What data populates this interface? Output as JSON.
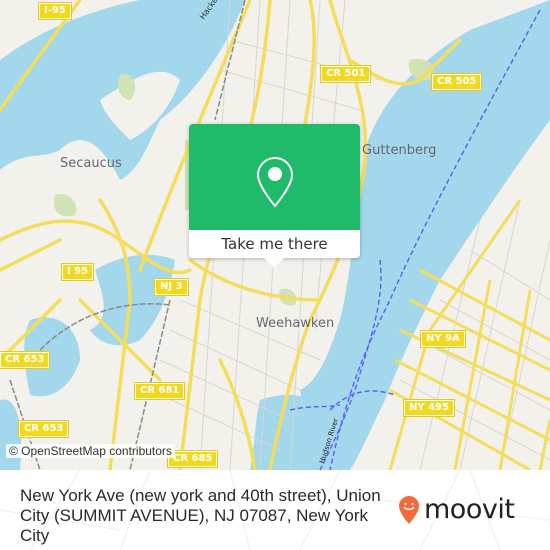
{
  "map": {
    "attribution": "© OpenStreetMap contributors",
    "colors": {
      "land": "#f2f1ec",
      "water": "#a3d7ec",
      "park": "#cfe3b4",
      "road_major": "#f5dd5c",
      "road_minor": "#d8d6cf",
      "rail": "#8a8a8a",
      "ferry": "#5a5ef0"
    },
    "place_labels": [
      {
        "name": "Secaucus"
      },
      {
        "name": "Guttenberg"
      },
      {
        "name": "Weehawken"
      }
    ],
    "water_labels": [
      {
        "name": "Hackensack River"
      },
      {
        "name": "Hudson River"
      }
    ],
    "road_shields": [
      {
        "label": "I-95"
      },
      {
        "label": "CR 501"
      },
      {
        "label": "CR 505"
      },
      {
        "label": "I 95"
      },
      {
        "label": "NJ 3"
      },
      {
        "label": "CR 653"
      },
      {
        "label": "CR 681"
      },
      {
        "label": "CR 653"
      },
      {
        "label": "CR 685"
      },
      {
        "label": "NY 9A"
      },
      {
        "label": "NY 495"
      }
    ]
  },
  "popup": {
    "icon": "map-pin-icon",
    "button_label": "Take me there",
    "color": "#1fba6a"
  },
  "footer": {
    "address": "New York Ave (new york and 40th street), Union City (SUMMIT AVENUE), NJ 07087, New York City",
    "brand": "moovit",
    "brand_color": "#f26b3a"
  }
}
